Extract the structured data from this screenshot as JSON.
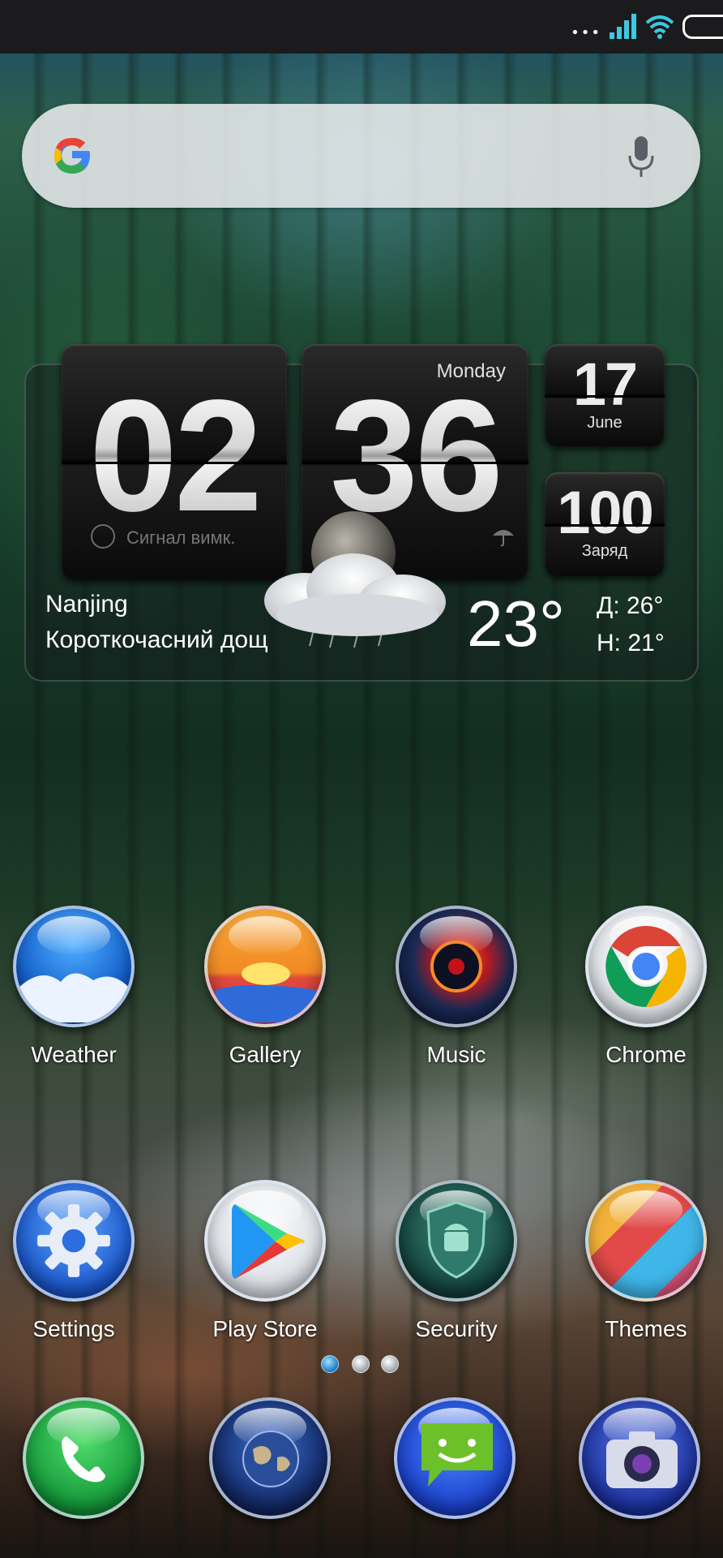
{
  "status_bar": {
    "more": "•••"
  },
  "search": {
    "placeholder": ""
  },
  "clock": {
    "hours": "02",
    "minutes": "36",
    "day": "Monday",
    "date": "17",
    "month": "June",
    "battery_level": "100",
    "battery_label": "Заряд",
    "alarm": "Сигнал вимк."
  },
  "weather": {
    "city": "Nanjing",
    "condition": "Короткочасний дощ",
    "temperature": "23°",
    "high": "Д:  26°",
    "low": "Н:  21°"
  },
  "apps_row1": [
    {
      "label": "Weather",
      "icon": "weather-icon"
    },
    {
      "label": "Gallery",
      "icon": "gallery-icon"
    },
    {
      "label": "Music",
      "icon": "music-icon"
    },
    {
      "label": "Chrome",
      "icon": "chrome-icon"
    }
  ],
  "apps_row2": [
    {
      "label": "Settings",
      "icon": "gear-icon"
    },
    {
      "label": "Play Store",
      "icon": "play-store-icon"
    },
    {
      "label": "Security",
      "icon": "shield-icon"
    },
    {
      "label": "Themes",
      "icon": "themes-icon"
    }
  ],
  "dock": [
    {
      "icon": "phone-icon"
    },
    {
      "icon": "globe-icon"
    },
    {
      "icon": "messages-icon"
    },
    {
      "icon": "camera-icon"
    }
  ],
  "pages": {
    "count": 3,
    "active": 0
  },
  "colors": {
    "search_bg": "#eceef0",
    "status_bg": "#1b1b1d",
    "page_dot_active": "#1a78c8"
  }
}
